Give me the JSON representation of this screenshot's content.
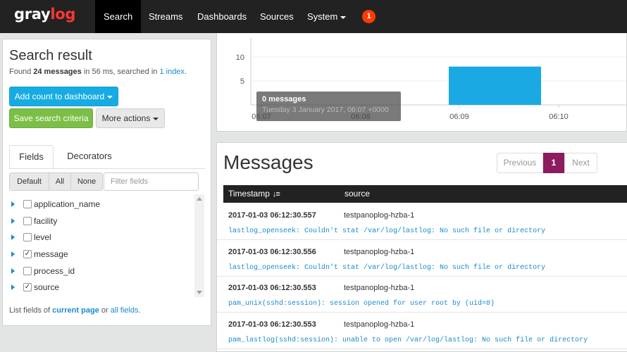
{
  "brand": {
    "logo_part1": "gray",
    "logo_part2": "log"
  },
  "nav": {
    "search": "Search",
    "streams": "Streams",
    "dashboards": "Dashboards",
    "sources": "Sources",
    "system": "System",
    "notification_count": "1"
  },
  "search_result": {
    "title": "Search result",
    "found_prefix": "Found",
    "count_text": "24 messages",
    "time_text": "in 56 ms, searched in",
    "index_link": "1 index",
    "index_suffix": "."
  },
  "actions": {
    "add_count": "Add count to dashboard",
    "save_search": "Save search criteria",
    "more_actions": "More actions"
  },
  "tabs": {
    "fields": "Fields",
    "decorators": "Decorators"
  },
  "field_filter": {
    "default": "Default",
    "all": "All",
    "none": "None",
    "placeholder": "Filter fields"
  },
  "fields": [
    {
      "name": "application_name",
      "checked": false
    },
    {
      "name": "facility",
      "checked": false
    },
    {
      "name": "level",
      "checked": false
    },
    {
      "name": "message",
      "checked": true
    },
    {
      "name": "process_id",
      "checked": false
    },
    {
      "name": "source",
      "checked": true
    }
  ],
  "list_hint": {
    "prefix": "List fields of",
    "current_page": "current page",
    "or": "or",
    "all_fields": "all fields",
    "suffix": "."
  },
  "histogram": {
    "tooltip_title": "0 messages",
    "tooltip_sub": "Tuesday 3 January 2017, 06:07 +0000",
    "bar_color": "#1aa9e3"
  },
  "chart_data": {
    "type": "bar",
    "x_tick_labels": [
      "06:07",
      "06:08",
      "06:09",
      "06:10"
    ],
    "y_tick_labels": [
      "10",
      "5"
    ],
    "ylim": [
      0,
      14
    ],
    "bars": [
      {
        "start": "06:09",
        "end": "06:10",
        "value": 8
      }
    ],
    "title": "",
    "xlabel": "",
    "ylabel": ""
  },
  "messages": {
    "title": "Messages",
    "pagination": {
      "previous": "Previous",
      "current": "1",
      "next": "Next"
    },
    "columns": {
      "timestamp": "Timestamp",
      "source": "source"
    },
    "rows": [
      {
        "timestamp": "2017-01-03 06:12:30.557",
        "source": "testpanoplog-hzba-1",
        "message": "lastlog_openseek: Couldn't stat /var/log/lastlog: No such file or directory"
      },
      {
        "timestamp": "2017-01-03 06:12:30.556",
        "source": "testpanoplog-hzba-1",
        "message": "lastlog_openseek: Couldn't stat /var/log/lastlog: No such file or directory"
      },
      {
        "timestamp": "2017-01-03 06:12:30.553",
        "source": "testpanoplog-hzba-1",
        "message": "pam_unix(sshd:session): session opened for user root by (uid=0)"
      },
      {
        "timestamp": "2017-01-03 06:12:30.553",
        "source": "testpanoplog-hzba-1",
        "message": "pam_lastlog(sshd:session): unable to open /var/log/lastlog: No such file or directory"
      }
    ]
  }
}
